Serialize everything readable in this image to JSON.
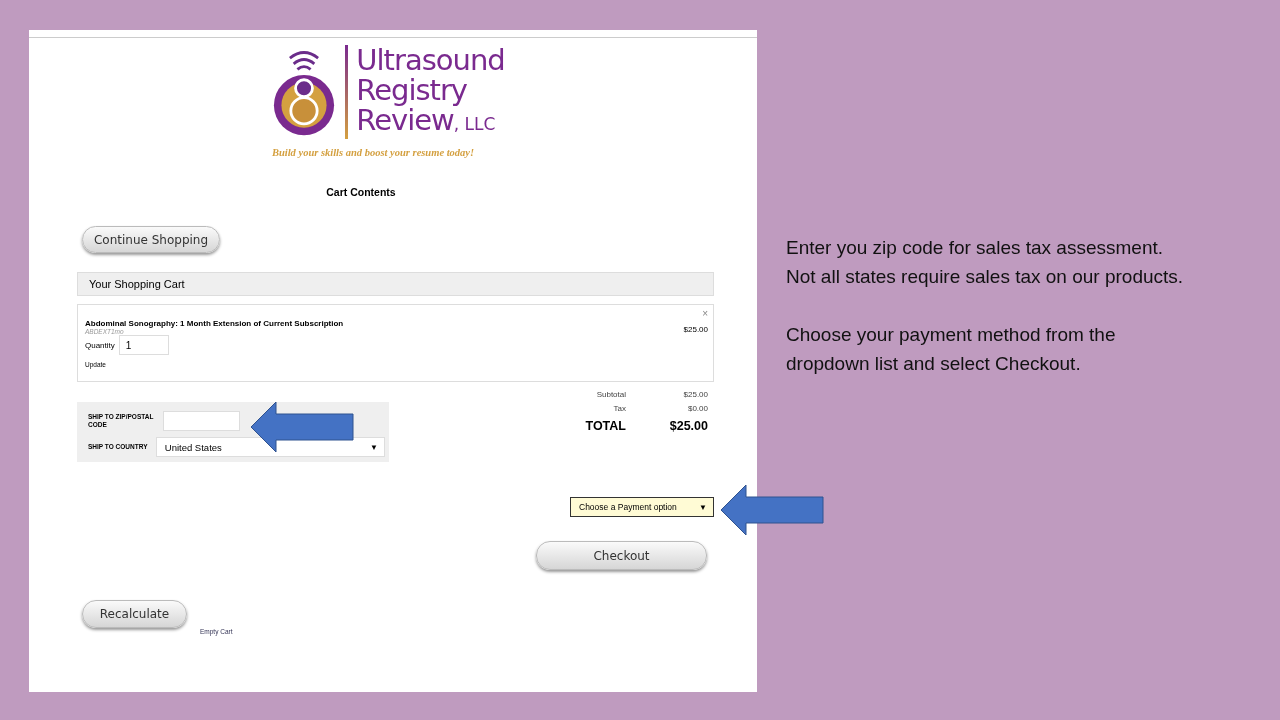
{
  "page": {
    "logo": {
      "line_1": "Ultrasound",
      "line_2": "Registry",
      "line_3": "Review",
      "suffix": ", LLC",
      "tagline": "Build your skills and boost your resume today!"
    },
    "heading": "Cart Contents",
    "continue_button": "Continue Shopping",
    "cart": {
      "title": "Your Shopping Cart",
      "items": [
        {
          "name": "Abdominal Sonography: 1 Month Extension of Current Subscription",
          "sku": "ABDEXT1mo",
          "quantity_label": "Quantity",
          "quantity": "1",
          "update_link": "Update",
          "price": "$25.00",
          "remove": "×"
        }
      ]
    },
    "shipping": {
      "zip_label": "SHIP TO ZIP/POSTAL CODE",
      "country_label": "SHIP TO COUNTRY",
      "country_value": "United States",
      "caret": "▼"
    },
    "totals": [
      {
        "kind": "line",
        "label": "Subtotal",
        "value": "$25.00"
      },
      {
        "kind": "line",
        "label": "Tax",
        "value": "$0.00"
      },
      {
        "kind": "grand",
        "label": "TOTAL",
        "value": "$25.00"
      }
    ],
    "payment": {
      "value": "Choose a Payment option",
      "caret": "▼"
    },
    "checkout_button": "Checkout",
    "recalculate_button": "Recalculate",
    "empty_cart_link": "Empty Cart"
  },
  "notes": {
    "lines": [
      "Enter you zip code for sales tax assessment.",
      "Not all states require sales tax on our products."
    ],
    "paragraph": "Choose your payment method from the dropdown list and select Checkout."
  }
}
